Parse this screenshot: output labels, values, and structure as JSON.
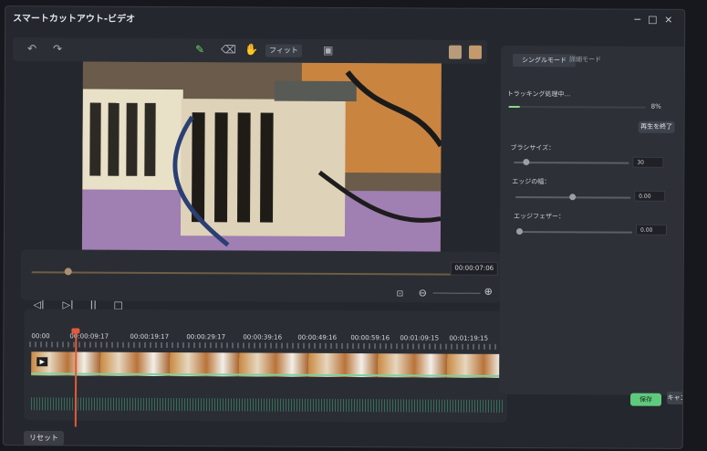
{
  "window": {
    "title": "スマートカットアウト-ビデオ",
    "controls": {
      "minimize": "−",
      "maximize": "□",
      "close": "×"
    }
  },
  "toolbar": {
    "undo_icon": "undo-icon",
    "redo_icon": "redo-icon",
    "fit_label": "フィット",
    "fit_chevron": "⌄"
  },
  "mode_tabs": [
    {
      "label": "シングルモード",
      "selected": true
    },
    {
      "label": "詳細モード",
      "selected": false
    }
  ],
  "tracking": {
    "status": "トラッキング処理中...",
    "progress_text": "8%",
    "progress": 0.08,
    "stop_label": "再生を終了"
  },
  "settings": [
    {
      "label": "ブラシサイズ：",
      "value": "30"
    },
    {
      "label": "エッジの幅：",
      "value": "0.00"
    },
    {
      "label": "エッジフェザー：",
      "value": "0.00"
    }
  ],
  "playback": {
    "time": "00:00:07:06"
  },
  "timeline": {
    "ticks": [
      "00:00",
      "00:00:09:17",
      "00:00:19:17",
      "00:00:29:17",
      "00:00:39:16",
      "00:00:49:16",
      "00:00:59:16",
      "00:01:09:15",
      "00:01:19:15"
    ]
  },
  "footer": {
    "save_label": "保存",
    "cancel_label": "キャンセル",
    "reset_label": "リセット"
  },
  "colors": {
    "accent_green": "#5fca7e",
    "playhead": "#e35a38",
    "waveform": "#78d3a0"
  }
}
